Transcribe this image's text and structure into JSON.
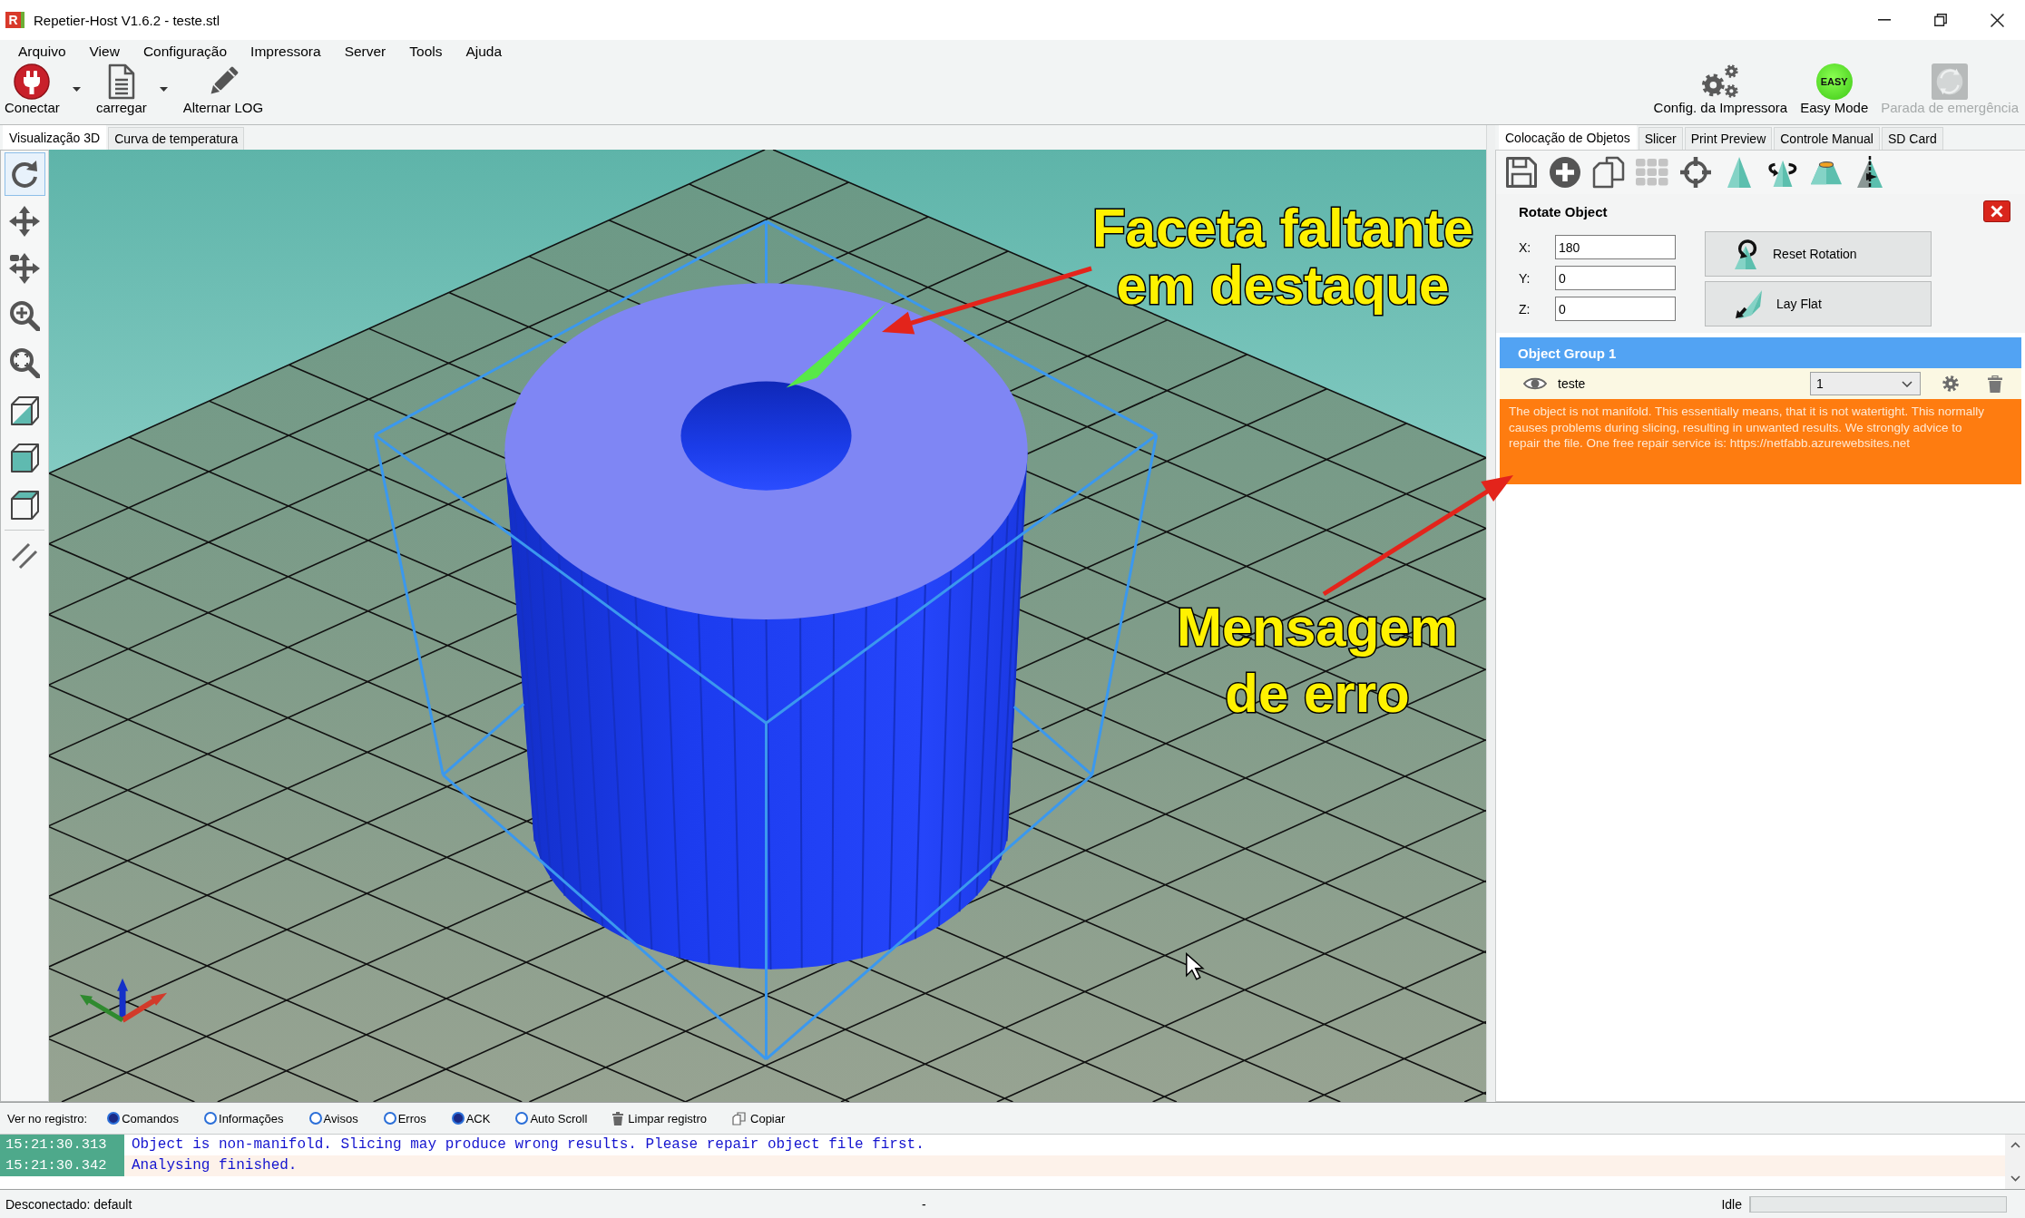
{
  "window": {
    "icon_letter": "R",
    "title": "Repetier-Host V1.6.2 - teste.stl"
  },
  "menu": [
    "Arquivo",
    "View",
    "Configuração",
    "Impressora",
    "Server",
    "Tools",
    "Ajuda"
  ],
  "toolbar": {
    "left": [
      {
        "kind": "connect",
        "label": "Conectar",
        "dropdown": true
      },
      {
        "kind": "load",
        "label": "carregar",
        "dropdown": true
      },
      {
        "kind": "log",
        "label": "Alternar LOG",
        "dropdown": false
      }
    ],
    "right": [
      {
        "kind": "printer_settings",
        "label": "Config. da Impressora",
        "disabled": false
      },
      {
        "kind": "easy_mode",
        "label": "Easy Mode",
        "badge": "EASY",
        "disabled": false
      },
      {
        "kind": "emergency_stop",
        "label": "Parada de emergência",
        "disabled": true
      }
    ]
  },
  "view_tabs": [
    {
      "label": "Visualização 3D",
      "selected": true
    },
    {
      "label": "Curva de temperatura",
      "selected": false
    }
  ],
  "view_tools": [
    {
      "items": [
        {
          "kind": "rotate",
          "selected": true
        },
        {
          "kind": "move",
          "selected": false
        },
        {
          "kind": "move_object",
          "selected": false
        },
        {
          "kind": "zoom",
          "selected": false
        },
        {
          "kind": "fit",
          "selected": false
        },
        {
          "kind": "iso_view",
          "selected": false
        },
        {
          "kind": "front_view",
          "selected": false
        },
        {
          "kind": "top_view",
          "selected": false
        }
      ]
    },
    {
      "items": [
        {
          "kind": "parallel",
          "selected": false
        }
      ]
    }
  ],
  "viewport": {
    "annotations": [
      {
        "lines": [
          "Faceta faltante",
          "em destaque"
        ]
      },
      {
        "lines": [
          "Mensagem",
          "de erro"
        ]
      }
    ]
  },
  "object_tabs": [
    {
      "label": "Colocação de Objetos",
      "selected": true
    },
    {
      "label": "Slicer",
      "selected": false
    },
    {
      "label": "Print Preview",
      "selected": false
    },
    {
      "label": "Controle Manual",
      "selected": false
    },
    {
      "label": "SD Card",
      "selected": false
    }
  ],
  "object_tools": [
    {
      "kind": "save",
      "disabled": false
    },
    {
      "kind": "add",
      "disabled": false
    },
    {
      "kind": "copy",
      "disabled": false
    },
    {
      "kind": "arrange",
      "disabled": true
    },
    {
      "kind": "center",
      "disabled": false
    },
    {
      "kind": "scale",
      "disabled": false
    },
    {
      "kind": "rotate",
      "disabled": false
    },
    {
      "kind": "cut",
      "disabled": false
    },
    {
      "kind": "mirror",
      "disabled": false
    }
  ],
  "rotate_panel": {
    "title": "Rotate Object",
    "fields": [
      {
        "label": "X:",
        "value": "180"
      },
      {
        "label": "Y:",
        "value": "0"
      },
      {
        "label": "Z:",
        "value": "0"
      }
    ],
    "buttons": [
      {
        "kind": "reset",
        "label": "Reset Rotation"
      },
      {
        "kind": "lay_flat",
        "label": "Lay Flat"
      }
    ]
  },
  "object_group": {
    "title": "Object Group 1",
    "objects": [
      {
        "name": "teste",
        "visible": true,
        "copies": "1",
        "message": "The object is not manifold. This essentially means, that it is not watertight. This normally causes problems during slicing, resulting in unwanted results. We strongly advice to repair the file. One free repair service is: https://netfabb.azurewebsites.net"
      }
    ]
  },
  "log": {
    "label": "Ver no registro:",
    "filters": [
      {
        "label": "Comandos",
        "checked": true
      },
      {
        "label": "Informações",
        "checked": false
      },
      {
        "label": "Avisos",
        "checked": false
      },
      {
        "label": "Erros",
        "checked": false
      },
      {
        "label": "ACK",
        "checked": true
      },
      {
        "label": "Auto Scroll",
        "checked": false
      }
    ],
    "actions": [
      {
        "kind": "clear",
        "label": "Limpar registro"
      },
      {
        "kind": "copy",
        "label": "Copiar"
      }
    ],
    "entries": [
      {
        "time": "15:21:30.313",
        "text": "Object is non-manifold. Slicing may produce wrong results. Please repair object file first."
      },
      {
        "time": "15:21:30.342",
        "text": "Analysing finished."
      }
    ]
  },
  "status_bar": {
    "connection": "Desconectado: default",
    "job": "-",
    "state": "Idle",
    "progress": {
      "level": 0
    }
  }
}
